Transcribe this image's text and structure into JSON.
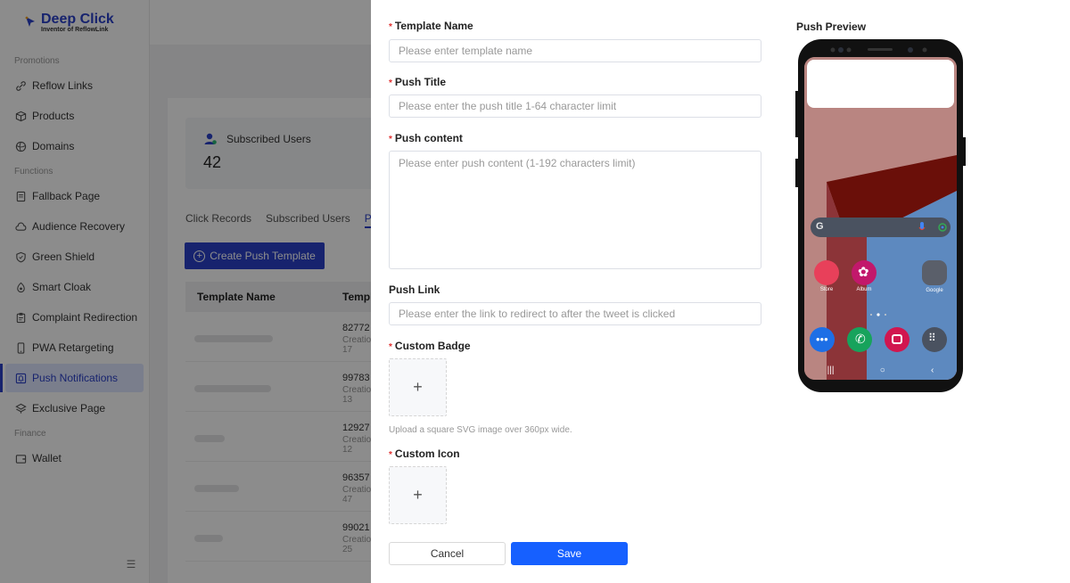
{
  "brand": {
    "name": "Deep Click",
    "tagline": "Inventor of ReflowLink"
  },
  "sidebar": {
    "groups": [
      {
        "title": "Promotions",
        "items": [
          {
            "label": "Reflow Links",
            "icon": "link-icon"
          },
          {
            "label": "Products",
            "icon": "box-icon"
          },
          {
            "label": "Domains",
            "icon": "globe-icon"
          }
        ]
      },
      {
        "title": "Functions",
        "items": [
          {
            "label": "Fallback Page",
            "icon": "page-icon"
          },
          {
            "label": "Audience Recovery",
            "icon": "cloud-icon"
          },
          {
            "label": "Green Shield",
            "icon": "shield-icon"
          },
          {
            "label": "Smart Cloak",
            "icon": "cloak-icon"
          },
          {
            "label": "Complaint Redirection",
            "icon": "clipboard-icon"
          },
          {
            "label": "PWA Retargeting",
            "icon": "phone-icon"
          },
          {
            "label": "Push Notifications",
            "icon": "bell-icon",
            "active": true
          },
          {
            "label": "Exclusive Page",
            "icon": "layers-icon"
          }
        ]
      },
      {
        "title": "Finance",
        "items": [
          {
            "label": "Wallet",
            "icon": "wallet-icon"
          }
        ]
      }
    ]
  },
  "stats": {
    "subscribed_label": "Subscribed Users",
    "subscribed_value": "42"
  },
  "tabs": [
    "Click Records",
    "Subscribed Users",
    "P"
  ],
  "create_button": "Create Push Template",
  "table": {
    "headers": [
      "Template Name",
      "Templ"
    ],
    "rows": [
      {
        "id": "82772",
        "sub1": "Creatio",
        "sub2": "17"
      },
      {
        "id": "99783",
        "sub1": "Creatio",
        "sub2": "13"
      },
      {
        "id": "12927",
        "sub1": "Creatio",
        "sub2": "12"
      },
      {
        "id": "96357",
        "sub1": "Creatio",
        "sub2": "47"
      },
      {
        "id": "99021",
        "sub1": "Creatio",
        "sub2": "25"
      }
    ]
  },
  "form": {
    "template_name": {
      "label": "Template Name",
      "placeholder": "Please enter template name",
      "value": ""
    },
    "push_title": {
      "label": "Push Title",
      "placeholder": "Please enter the push title 1-64 character limit",
      "value": ""
    },
    "push_content": {
      "label": "Push content",
      "placeholder": "Please enter push content (1-192 characters limit)",
      "value": ""
    },
    "push_link": {
      "label": "Push Link",
      "placeholder": "Please enter the link to redirect to after the tweet is clicked",
      "value": ""
    },
    "custom_badge": {
      "label": "Custom Badge",
      "hint": "Upload a square SVG image over 360px wide."
    },
    "custom_icon": {
      "label": "Custom Icon"
    },
    "required_mark": "*",
    "plus": "+",
    "cancel": "Cancel",
    "save": "Save"
  },
  "preview": {
    "title": "Push Preview",
    "apps": {
      "store": "Store",
      "album": "Album",
      "google": "Google"
    }
  },
  "colors": {
    "accent": "#2a40c9",
    "save": "#1660ff",
    "required": "#e03030"
  }
}
